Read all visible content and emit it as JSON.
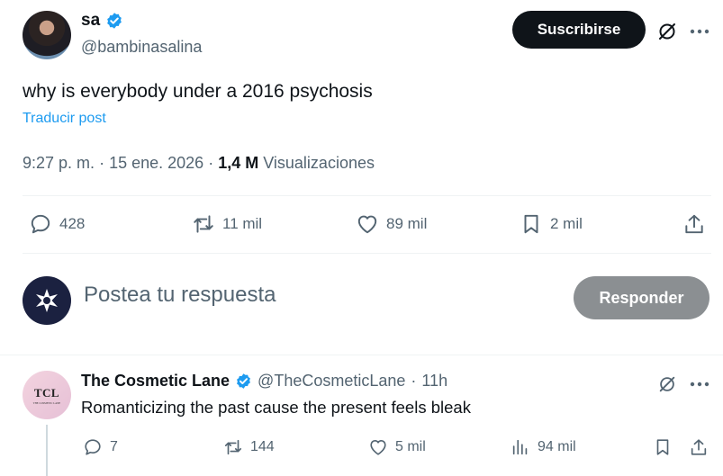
{
  "post": {
    "author_name": "sa",
    "author_handle": "@bambinasalina",
    "subscribe_label": "Suscribirse",
    "text": "why is everybody under a 2016 psychosis",
    "translate_label": "Traducir post",
    "time": "9:27 p. m.",
    "date": "15 ene. 2026",
    "views_count": "1,4 M",
    "views_label": "Visualizaciones",
    "replies": "428",
    "reposts": "11 mil",
    "likes": "89 mil",
    "bookmarks": "2 mil"
  },
  "compose": {
    "placeholder": "Postea tu respuesta",
    "reply_button": "Responder"
  },
  "reply": {
    "avatar_text": "TCL",
    "avatar_subtext": "THE COSMETIC LANE",
    "author_name": "The Cosmetic Lane",
    "author_handle": "@TheCosmeticLane",
    "separator": "·",
    "time": "11h",
    "text": "Romanticizing the past cause the present feels bleak",
    "replies": "7",
    "reposts": "144",
    "likes": "5 mil",
    "views": "94 mil"
  },
  "colors": {
    "accent": "#1d9bf0",
    "text": "#0f1419",
    "muted": "#536471",
    "subscribe_bg": "#0f1419",
    "reply_button_bg": "#8b8f92"
  },
  "icons": [
    "verified-badge-icon",
    "grok-icon",
    "more-icon",
    "reply-icon",
    "repost-icon",
    "like-icon",
    "bookmark-icon",
    "share-icon",
    "analytics-icon",
    "user-avatar-icon"
  ]
}
